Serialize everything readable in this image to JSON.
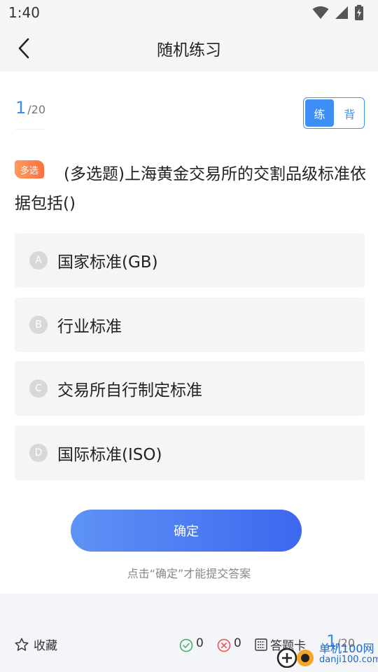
{
  "status_bar": {
    "time": "1:40"
  },
  "header": {
    "title": "随机练习"
  },
  "progress": {
    "current": "1",
    "total": "/20"
  },
  "mode_toggle": {
    "practice": "练",
    "memorize": "背"
  },
  "question": {
    "badge": "多选",
    "text": "(多选题)上海黄金交易所的交割品级标准依据包括()"
  },
  "options": [
    {
      "letter": "A",
      "text": "国家标准(GB)"
    },
    {
      "letter": "B",
      "text": "行业标准"
    },
    {
      "letter": "C",
      "text": "交易所自行制定标准"
    },
    {
      "letter": "D",
      "text": "国际标准(ISO)"
    }
  ],
  "confirm": {
    "label": "确定",
    "hint": "点击“确定”才能提交答案"
  },
  "bottom_bar": {
    "favorite_label": "收藏",
    "correct_count": "0",
    "wrong_count": "0",
    "answer_card_label": "答题卡",
    "progress_current": "1",
    "progress_total": "/20"
  },
  "watermark": {
    "name": "单机100网",
    "url": "danji100.com"
  },
  "colors": {
    "accent": "#3e8ef7",
    "badge": "#ff7a45",
    "correct": "#3cb371",
    "wrong": "#ef5350"
  }
}
